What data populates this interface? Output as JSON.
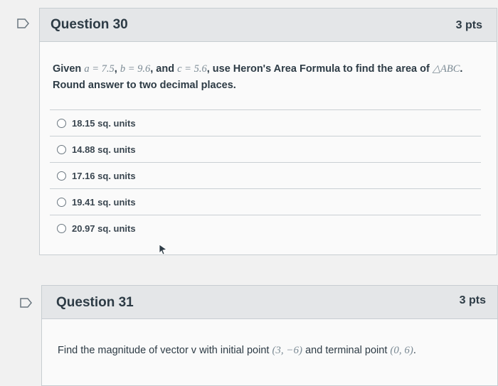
{
  "q30": {
    "title": "Question 30",
    "points": "3 pts",
    "prompt_prefix": "Given",
    "a_expr": "a = 7.5",
    "sep1": ",",
    "b_expr": "b = 9.6",
    "and_word": ", and",
    "c_expr": "c = 5.6",
    "prompt_mid": ", use Heron's Area Formula to find the area of",
    "triangle": "△ABC",
    "prompt_end": ".",
    "prompt_line2": "Round answer to two decimal places.",
    "answers": [
      "18.15 sq. units",
      "14.88 sq. units",
      "17.16 sq. units",
      "19.41 sq. units",
      "20.97 sq. units"
    ]
  },
  "q31": {
    "title": "Question 31",
    "points": "3 pts",
    "prompt_prefix": "Find the magnitude of vector v with initial point",
    "initial_point": "(3, −6)",
    "prompt_mid": "and terminal point",
    "terminal_point": "(0, 6)",
    "prompt_end": "."
  },
  "colors": {
    "header_bg": "#e4e6e8",
    "card_bg": "#fafafa",
    "border": "#c7cdd1",
    "text": "#2d3b45"
  }
}
